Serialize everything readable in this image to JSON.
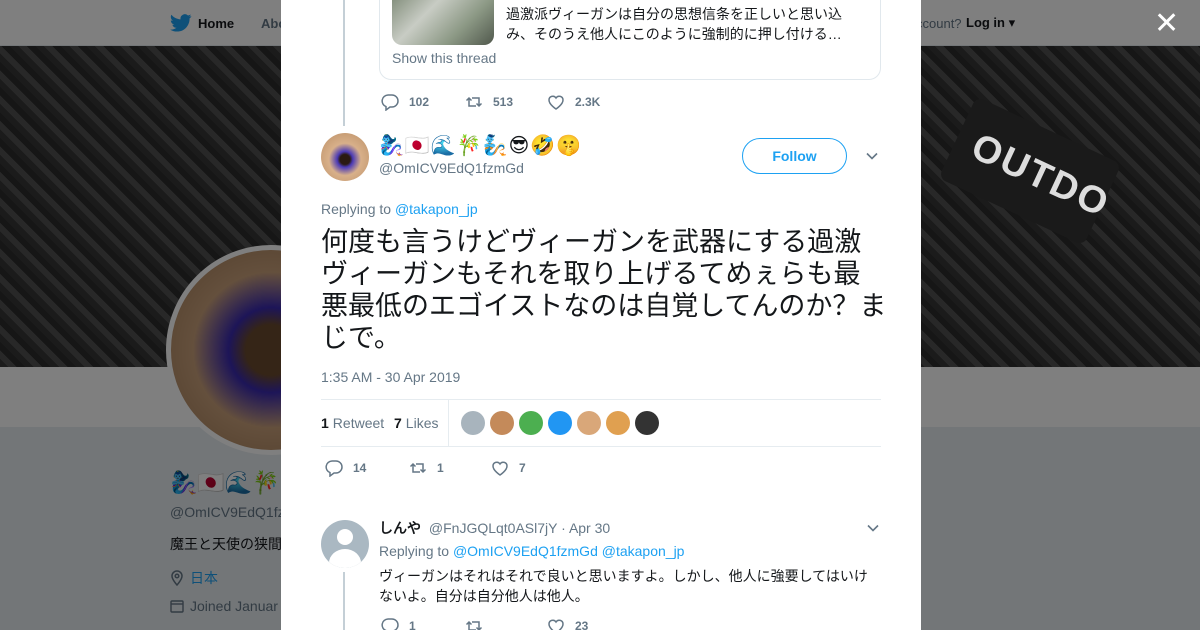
{
  "topbar": {
    "home": "Home",
    "about": "Abo",
    "account": "ccount?",
    "login": "Log in"
  },
  "banner": {
    "brand": "OUTDO"
  },
  "profile": {
    "emoji": "🧞‍♀️🇯🇵🌊🎋",
    "handle": "@OmICV9EdQ1fzm",
    "bio": "魔王と天使の狭間",
    "location": "日本",
    "joined": "Joined Januar"
  },
  "quote": {
    "lines": [
      "過激派ヴィーガンは自分の思想信条を正しいと思い込",
      "み、そのうえ他人にこのように強制的に押し付ける…"
    ],
    "show_thread": "Show this thread"
  },
  "prev_actions": {
    "replies": "102",
    "retweets": "513",
    "likes": "2.3K"
  },
  "tweet": {
    "display_name": "🧞‍♀️🇯🇵🌊🎋🧞😎🤣🤫",
    "handle": "@OmICV9EdQ1fzmGd",
    "follow": "Follow",
    "replying_prefix": "Replying to",
    "replying_to": "@takapon_jp",
    "text": "何度も言うけどヴィーガンを武器にする過激ヴィーガンもそれを取り上げるてめぇらも最悪最低のエゴイストなのは自覚してんのか？まじで。",
    "timestamp": "1:35 AM - 30 Apr 2019",
    "retweets_count": "1",
    "retweets_label": "Retweet",
    "likes_count": "7",
    "likes_label": "Likes"
  },
  "likers": [
    "#a8b4bd",
    "#c48a5a",
    "#4caf50",
    "#2196f3",
    "#d9a779",
    "#e0a050",
    "#333333"
  ],
  "tweet_actions": {
    "replies": "14",
    "retweets": "1",
    "likes": "7"
  },
  "reply": {
    "name": "しんや",
    "handle": "@FnJGQLqt0ASl7jY",
    "sep": "·",
    "date": "Apr 30",
    "replying_prefix": "Replying to",
    "replying_to_1": "@OmICV9EdQ1fzmGd",
    "replying_to_2": "@takapon_jp",
    "text": "ヴィーガンはそれはそれで良いと思いますよ。しかし、他人に強要してはいけないよ。自分は自分他人は他人。",
    "replies": "1",
    "retweets": "",
    "likes": "23"
  }
}
